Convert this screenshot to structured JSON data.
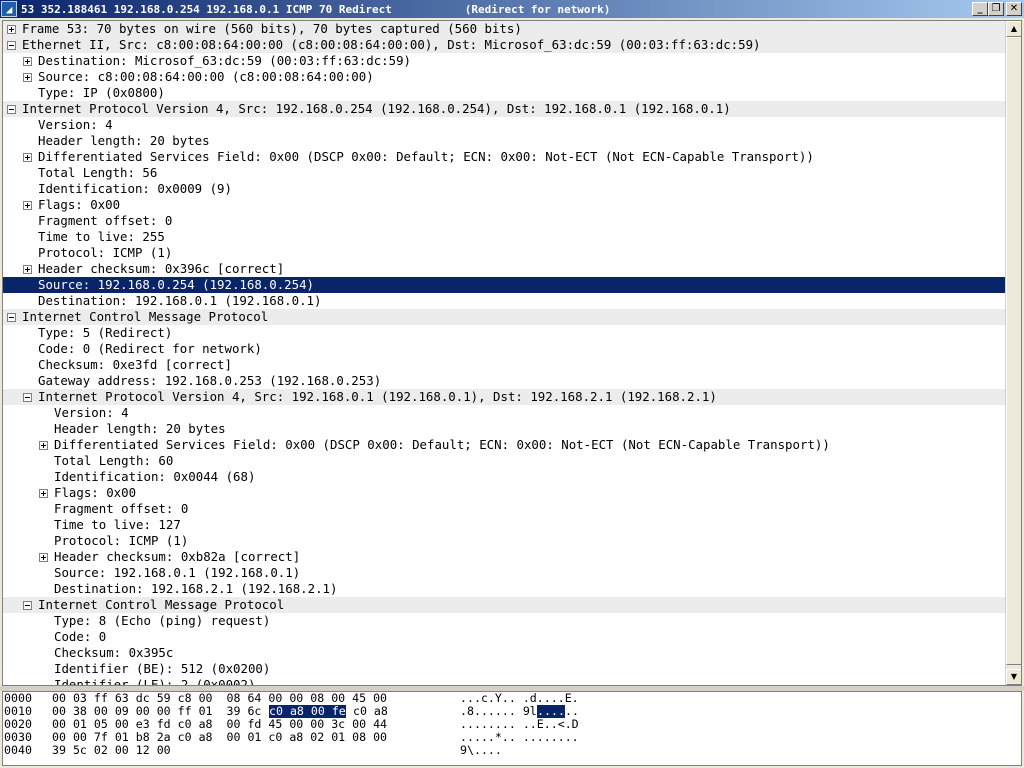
{
  "titlebar": {
    "app_icon": "wireshark-fin-icon",
    "title": "53 352.188461 192.168.0.254 192.168.0.1 ICMP 70 Redirect           (Redirect for network)",
    "minimize": "_",
    "maximize": "❐",
    "close": "✕"
  },
  "tree": [
    {
      "text": "Frame 53: 70 bytes on wire (560 bits), 70 bytes captured (560 bits)",
      "indent": 0,
      "toggle": "plus",
      "shade": true
    },
    {
      "text": "Ethernet II, Src: c8:00:08:64:00:00 (c8:00:08:64:00:00), Dst: Microsof_63:dc:59 (00:03:ff:63:dc:59)",
      "indent": 0,
      "toggle": "minus",
      "shade": true
    },
    {
      "text": "Destination: Microsof_63:dc:59 (00:03:ff:63:dc:59)",
      "indent": 1,
      "toggle": "plus"
    },
    {
      "text": "Source: c8:00:08:64:00:00 (c8:00:08:64:00:00)",
      "indent": 1,
      "toggle": "plus"
    },
    {
      "text": "Type: IP (0x0800)",
      "indent": 1
    },
    {
      "text": "Internet Protocol Version 4, Src: 192.168.0.254 (192.168.0.254), Dst: 192.168.0.1 (192.168.0.1)",
      "indent": 0,
      "toggle": "minus",
      "shade": true
    },
    {
      "text": "Version: 4",
      "indent": 1
    },
    {
      "text": "Header length: 20 bytes",
      "indent": 1
    },
    {
      "text": "Differentiated Services Field: 0x00 (DSCP 0x00: Default; ECN: 0x00: Not-ECT (Not ECN-Capable Transport))",
      "indent": 1,
      "toggle": "plus"
    },
    {
      "text": "Total Length: 56",
      "indent": 1
    },
    {
      "text": "Identification: 0x0009 (9)",
      "indent": 1
    },
    {
      "text": "Flags: 0x00",
      "indent": 1,
      "toggle": "plus"
    },
    {
      "text": "Fragment offset: 0",
      "indent": 1
    },
    {
      "text": "Time to live: 255",
      "indent": 1
    },
    {
      "text": "Protocol: ICMP (1)",
      "indent": 1
    },
    {
      "text": "Header checksum: 0x396c [correct]",
      "indent": 1,
      "toggle": "plus"
    },
    {
      "text": "Source: 192.168.0.254 (192.168.0.254)",
      "indent": 1,
      "selected": true
    },
    {
      "text": "Destination: 192.168.0.1 (192.168.0.1)",
      "indent": 1
    },
    {
      "text": "Internet Control Message Protocol",
      "indent": 0,
      "toggle": "minus",
      "shade": true
    },
    {
      "text": "Type: 5 (Redirect)",
      "indent": 1
    },
    {
      "text": "Code: 0 (Redirect for network)",
      "indent": 1
    },
    {
      "text": "Checksum: 0xe3fd [correct]",
      "indent": 1
    },
    {
      "text": "Gateway address: 192.168.0.253 (192.168.0.253)",
      "indent": 1
    },
    {
      "text": "Internet Protocol Version 4, Src: 192.168.0.1 (192.168.0.1), Dst: 192.168.2.1 (192.168.2.1)",
      "indent": 1,
      "toggle": "minus",
      "shade": true
    },
    {
      "text": "Version: 4",
      "indent": 2
    },
    {
      "text": "Header length: 20 bytes",
      "indent": 2
    },
    {
      "text": "Differentiated Services Field: 0x00 (DSCP 0x00: Default; ECN: 0x00: Not-ECT (Not ECN-Capable Transport))",
      "indent": 2,
      "toggle": "plus"
    },
    {
      "text": "Total Length: 60",
      "indent": 2
    },
    {
      "text": "Identification: 0x0044 (68)",
      "indent": 2
    },
    {
      "text": "Flags: 0x00",
      "indent": 2,
      "toggle": "plus"
    },
    {
      "text": "Fragment offset: 0",
      "indent": 2
    },
    {
      "text": "Time to live: 127",
      "indent": 2
    },
    {
      "text": "Protocol: ICMP (1)",
      "indent": 2
    },
    {
      "text": "Header checksum: 0xb82a [correct]",
      "indent": 2,
      "toggle": "plus"
    },
    {
      "text": "Source: 192.168.0.1 (192.168.0.1)",
      "indent": 2
    },
    {
      "text": "Destination: 192.168.2.1 (192.168.2.1)",
      "indent": 2
    },
    {
      "text": "Internet Control Message Protocol",
      "indent": 1,
      "toggle": "minus",
      "shade": true
    },
    {
      "text": "Type: 8 (Echo (ping) request)",
      "indent": 2
    },
    {
      "text": "Code: 0",
      "indent": 2
    },
    {
      "text": "Checksum: 0x395c",
      "indent": 2
    },
    {
      "text": "Identifier (BE): 512 (0x0200)",
      "indent": 2
    },
    {
      "text": "Identifier (LE): 2 (0x0002)",
      "indent": 2
    }
  ],
  "scrollbar": {
    "up": "▲",
    "down": "▼"
  },
  "hex": [
    {
      "offset": "0000",
      "bytes": "00 03 ff 63 dc 59 c8 00  08 64 00 00 08 00 45 00",
      "ascii": "...c.Y.. .d....E."
    },
    {
      "offset": "0010",
      "bytes_a": "00 38 00 09 00 00 ff 01  39 6c ",
      "bytes_hl": "c0 a8 00 fe",
      "bytes_b": " c0 a8",
      "ascii_a": ".8...... 9l",
      "ascii_hl": "....",
      "ascii_b": ".."
    },
    {
      "offset": "0020",
      "bytes": "00 01 05 00 e3 fd c0 a8  00 fd 45 00 00 3c 00 44",
      "ascii": "........ ..E..<.D"
    },
    {
      "offset": "0030",
      "bytes": "00 00 7f 01 b8 2a c0 a8  00 01 c0 a8 02 01 08 00",
      "ascii": ".....*.. ........"
    },
    {
      "offset": "0040",
      "bytes": "39 5c 02 00 12 00",
      "ascii": "9\\...."
    }
  ]
}
